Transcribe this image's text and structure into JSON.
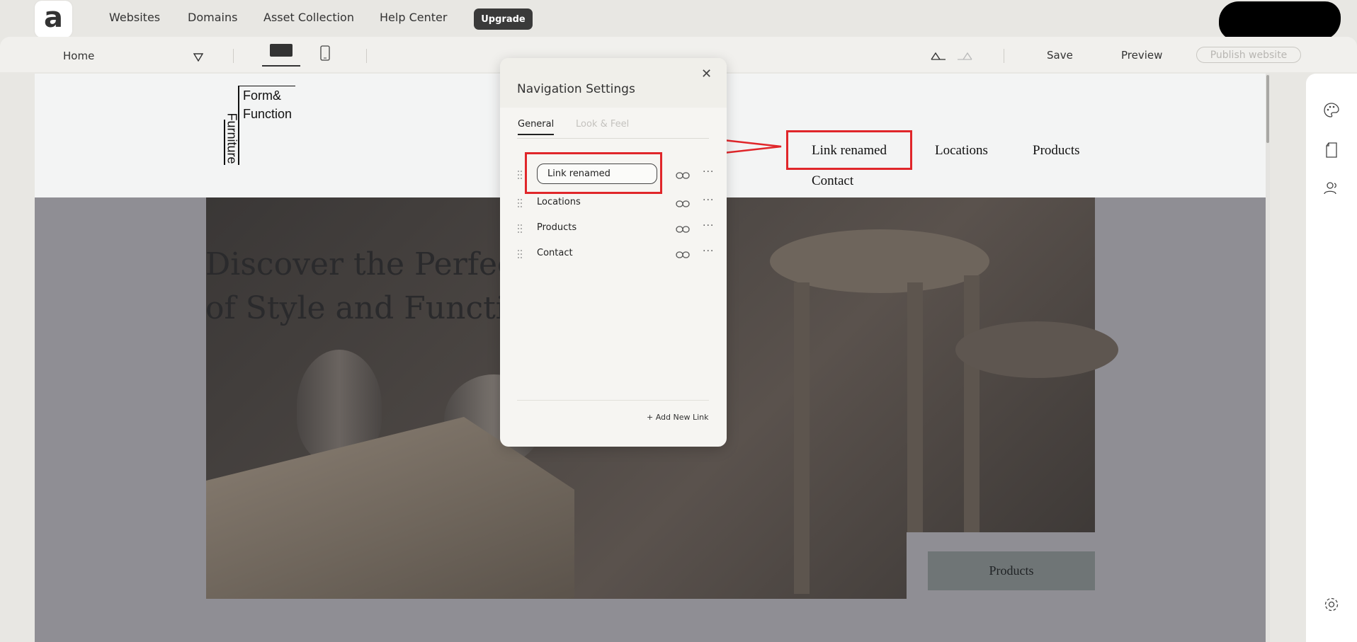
{
  "topbar": {
    "logo_letter": "a",
    "nav": [
      "Websites",
      "Domains",
      "Asset Collection",
      "Help Center"
    ],
    "upgrade_label": "Upgrade"
  },
  "toolbar": {
    "page_selected": "Home",
    "save_label": "Save",
    "preview_label": "Preview",
    "publish_label": "Publish website"
  },
  "site": {
    "logo_lines": [
      "Form&",
      "Function",
      "Furniture"
    ],
    "nav": [
      "Link renamed",
      "Locations",
      "Products",
      "Contact"
    ],
    "hero_title": "Discover the Perfec\nof Style and Functio",
    "products_button": "Products"
  },
  "nav_panel": {
    "title": "Navigation Settings",
    "tabs": [
      "General",
      "Look & Feel"
    ],
    "editing_value": "Link renamed",
    "links": [
      "Locations",
      "Products",
      "Contact"
    ],
    "add_label": "+ Add New Link"
  },
  "colors": {
    "highlight": "#e0262a",
    "upgrade_bg": "#3a3a3a",
    "hero_bg": "#8f8e94"
  }
}
